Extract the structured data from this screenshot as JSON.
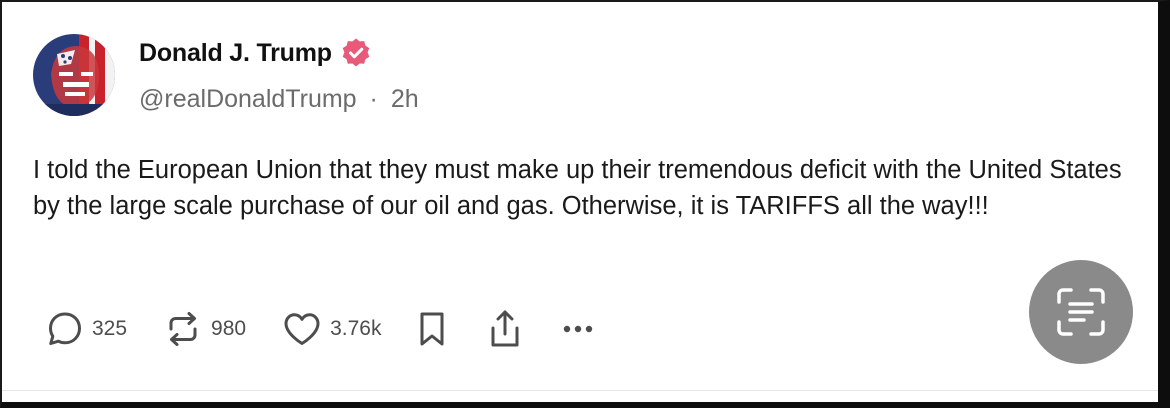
{
  "post": {
    "author": {
      "display_name": "Donald J. Trump",
      "handle": "@realDonaldTrump",
      "time_ago": "2h",
      "separator": "·",
      "verified": true,
      "avatar_icon": "american-flag-face-avatar"
    },
    "text": "I told the European Union that they must make up their tremendous deficit with the United States by the large scale purchase of our oil and gas. Otherwise, it is TARIFFS all the way!!!",
    "actions": {
      "replies": "325",
      "retruths": "980",
      "likes": "3.76k",
      "icons": [
        "reply-icon",
        "retruth-icon",
        "like-icon",
        "bookmark-icon",
        "share-icon",
        "more-icon"
      ]
    }
  },
  "overlay": {
    "lens_button_icon": "scan-text-icon"
  },
  "colors": {
    "verified_badge": "#e85a7a",
    "muted_text": "#6b6b6b",
    "body_text": "#1a1a1a",
    "lens_button_bg": "#8a8a8a"
  }
}
